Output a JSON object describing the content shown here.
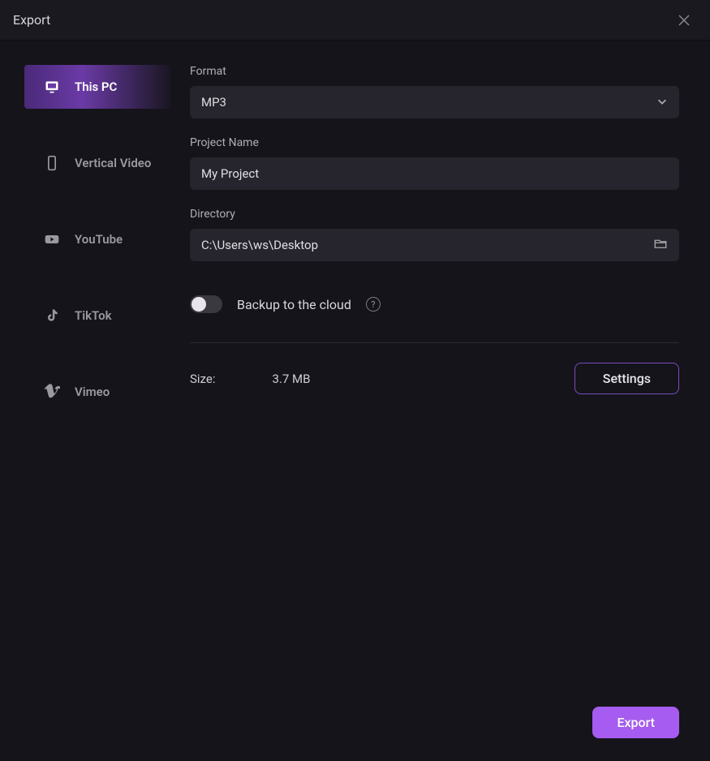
{
  "titlebar": {
    "title": "Export"
  },
  "sidebar": {
    "items": [
      {
        "id": "this-pc",
        "label": "This PC",
        "active": true
      },
      {
        "id": "vertical-video",
        "label": "Vertical Video",
        "active": false
      },
      {
        "id": "youtube",
        "label": "YouTube",
        "active": false
      },
      {
        "id": "tiktok",
        "label": "TikTok",
        "active": false
      },
      {
        "id": "vimeo",
        "label": "Vimeo",
        "active": false
      }
    ]
  },
  "main": {
    "format": {
      "label": "Format",
      "value": "MP3"
    },
    "project_name": {
      "label": "Project Name",
      "value": "My Project"
    },
    "directory": {
      "label": "Directory",
      "value": "C:\\Users\\ws\\Desktop"
    },
    "backup": {
      "label": "Backup to the cloud",
      "enabled": false
    },
    "size": {
      "label": "Size:",
      "value": "3.7 MB"
    },
    "settings_label": "Settings"
  },
  "footer": {
    "export_label": "Export"
  }
}
